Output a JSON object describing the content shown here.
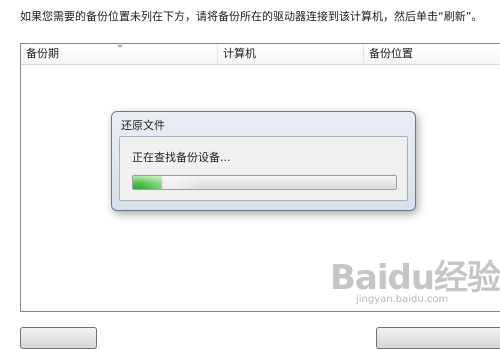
{
  "instruction_text": "如果您需要的备份位置未列在下方，请将备份所在的驱动器连接到该计算机，然后单击“刷新”。",
  "backup_list": {
    "columns": [
      "备份期",
      "计算机",
      "备份位置"
    ],
    "rows": []
  },
  "dialog": {
    "title": "还原文件",
    "message": "正在查找备份设备...",
    "progress_fraction": 0.11,
    "progress_color": "#4cc24f"
  },
  "watermark": {
    "logo_text": "Baidu经验",
    "url": "jingyan.baidu.com"
  },
  "colors": {
    "border": "#828790",
    "dialog_background": "#dde4ed"
  }
}
